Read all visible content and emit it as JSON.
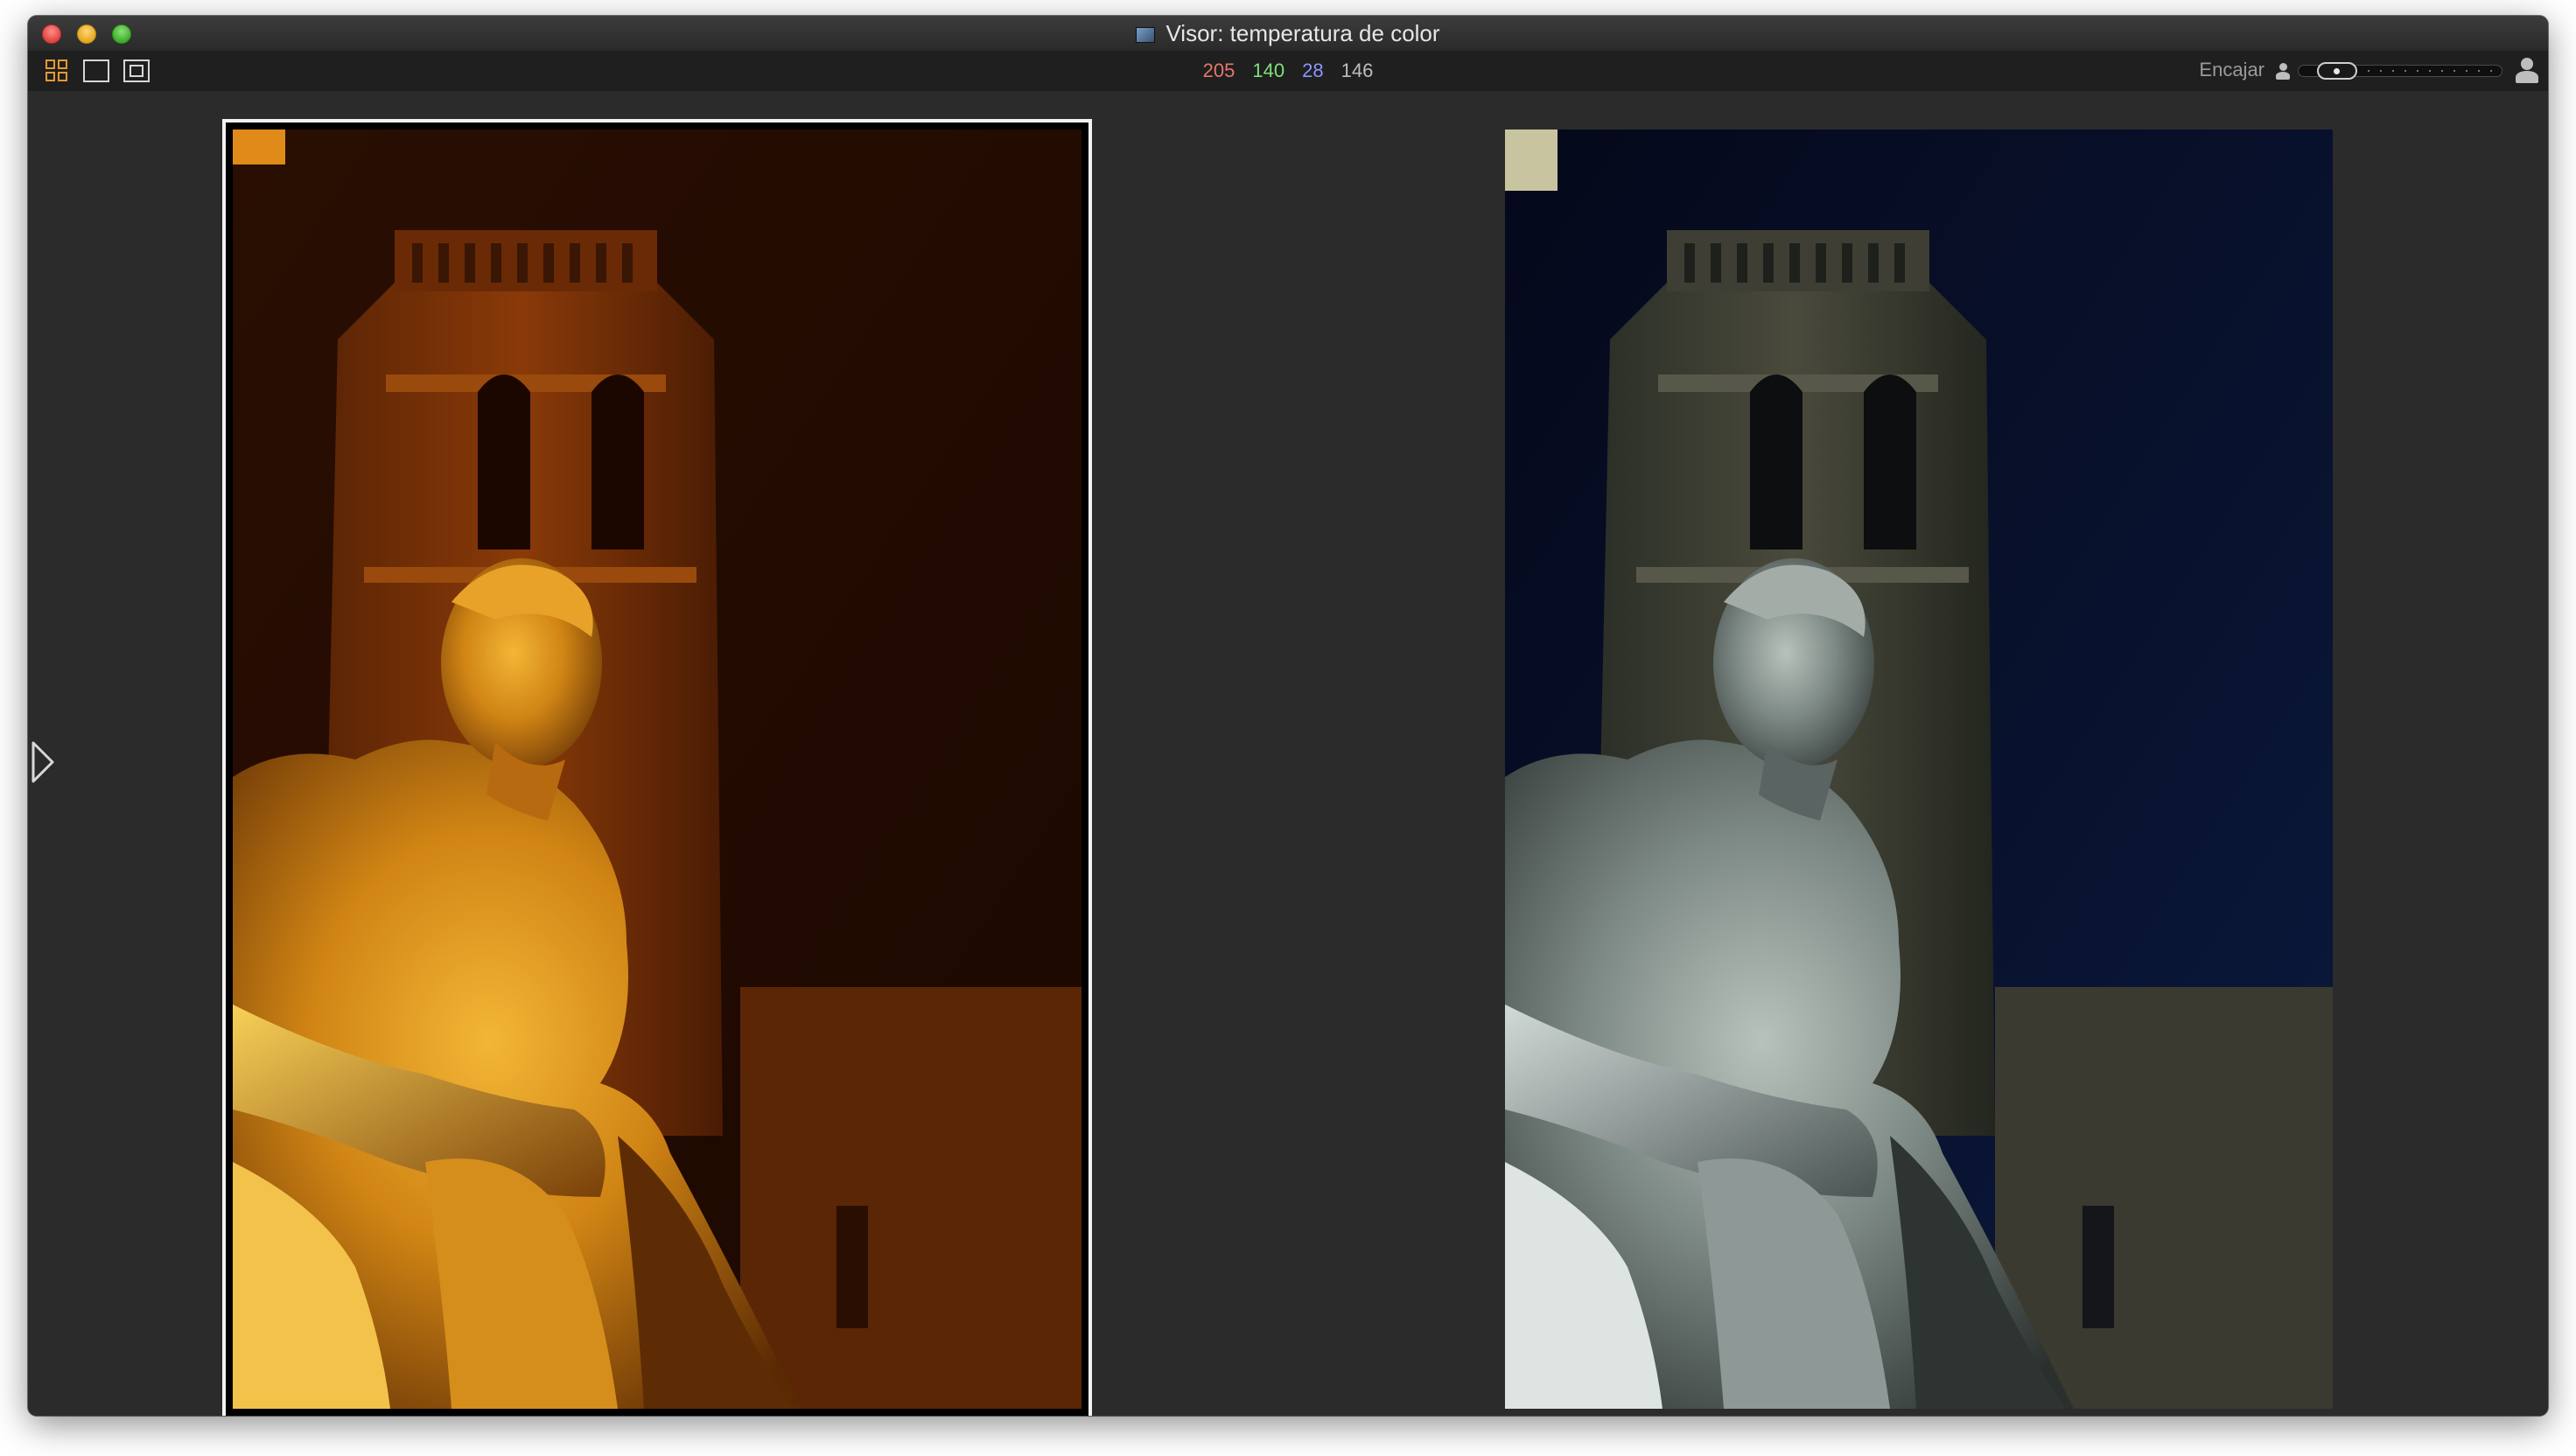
{
  "window": {
    "title": "Visor: temperatura de color",
    "title_icon": "viewer-icon"
  },
  "toolbar": {
    "view_buttons": [
      "grid-view-icon",
      "single-view-icon",
      "compare-view-icon"
    ],
    "pixel_readout": {
      "r": "205",
      "g": "140",
      "b": "28",
      "luma": "146"
    },
    "fit_label": "Encajar",
    "zoom_fraction": 0.1
  },
  "colors": {
    "window_bg": "#2b2b2b",
    "accent_orange": "#e29a32",
    "readout_r": "#e6766a",
    "readout_g": "#7fe07a",
    "readout_b": "#8a96ff",
    "readout_l": "#bdbdbd",
    "selection_border": "#f2f2f2"
  },
  "images": [
    {
      "name": "warm-version",
      "tone": "tungsten orange",
      "selected": true
    },
    {
      "name": "cool-version",
      "tone": "neutral blue",
      "selected": false
    }
  ]
}
